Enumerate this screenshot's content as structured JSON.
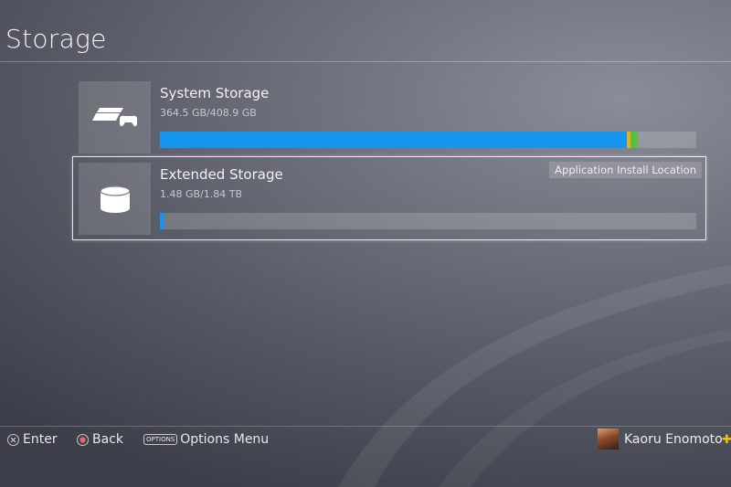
{
  "page": {
    "title": "Storage"
  },
  "storage_items": [
    {
      "name": "System Storage",
      "usage": "364.5 GB/408.9 GB",
      "icon": "ps4-console-icon",
      "used_fraction": 0.891,
      "selected": false
    },
    {
      "name": "Extended Storage",
      "usage": "1.48 GB/1.84 TB",
      "icon": "external-drive-icon",
      "used_fraction": 0.008,
      "selected": true,
      "tag": "Application Install Location"
    }
  ],
  "footer": {
    "enter_label": "Enter",
    "back_label": "Back",
    "options_glyph": "OPTIONS",
    "options_label": "Options Menu",
    "user_name": "Kaoru Enomoto"
  },
  "colors": {
    "bar_fill": "#1594f0",
    "bar_track": "rgba(255,255,255,0.17)",
    "plus_yellow": "#f2c400"
  }
}
